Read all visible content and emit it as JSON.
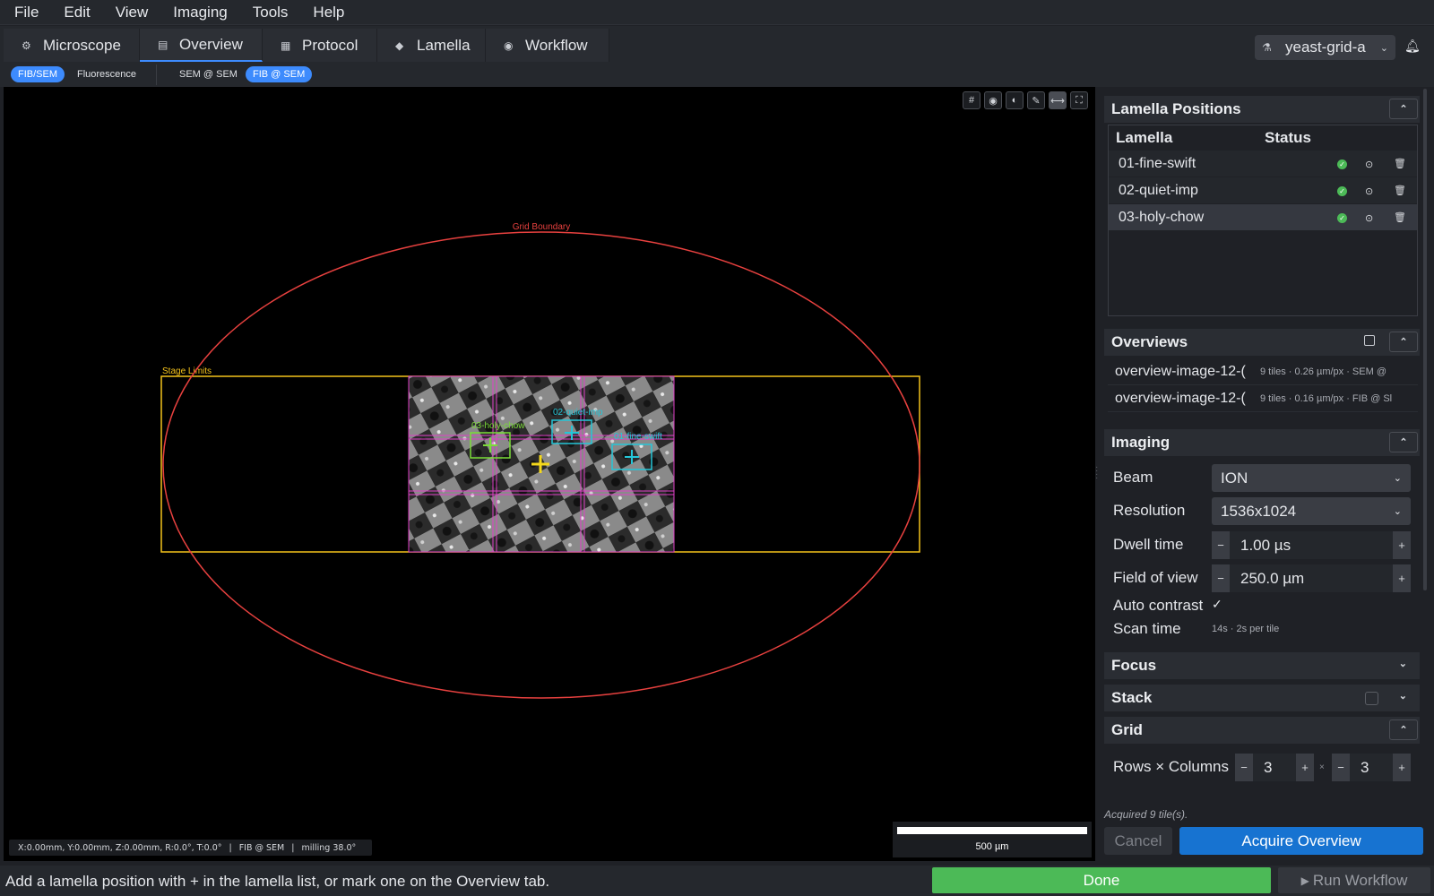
{
  "menu": [
    "File",
    "Edit",
    "View",
    "Imaging",
    "Tools",
    "Help"
  ],
  "tabs": [
    {
      "label": "Microscope",
      "icon": "microscope-icon",
      "glyph": "⚙"
    },
    {
      "label": "Overview",
      "icon": "map-icon",
      "glyph": "▤"
    },
    {
      "label": "Protocol",
      "icon": "document-icon",
      "glyph": "▦"
    },
    {
      "label": "Lamella",
      "icon": "layers-icon",
      "glyph": "◆"
    },
    {
      "label": "Workflow",
      "icon": "play-circle-icon",
      "glyph": "◉"
    }
  ],
  "active_tab": "Overview",
  "project": {
    "name": "yeast-grid-a"
  },
  "subbar": {
    "modes": [
      "FIB/SEM",
      "Fluorescence"
    ],
    "views": [
      "SEM @ SEM",
      "FIB @ SEM"
    ]
  },
  "viewer": {
    "grid_boundary_label": "Grid Boundary",
    "stage_limits_label": "Stage Limits",
    "markers": [
      {
        "label": "03-holy-chow",
        "color": "#7bdc38"
      },
      {
        "label": "02-quiet-imp",
        "color": "#24c6d8"
      },
      {
        "label": "01-fine-swift",
        "color": "#24c6d8"
      }
    ],
    "coords": "X:0.00mm, Y:0.00mm, Z:0.00mm, R:0.0°, T:0.0°",
    "coord_view": "FIB @ SEM",
    "coord_milling": "milling 38.0°",
    "scale_label": "500 µm",
    "toolbar_icons": [
      "grid-icon",
      "eye-icon",
      "contrast-icon",
      "pencil-icon",
      "measure-icon",
      "fit-view-icon"
    ]
  },
  "lamella_positions": {
    "title": "Lamella Positions",
    "columns": [
      "Lamella",
      "Status"
    ],
    "rows": [
      {
        "name": "01-fine-swift",
        "status": "complete"
      },
      {
        "name": "02-quiet-imp",
        "status": "complete"
      },
      {
        "name": "03-holy-chow",
        "status": "complete"
      }
    ]
  },
  "overviews": {
    "title": "Overviews",
    "items": [
      {
        "name": "overview-image-12-(",
        "meta": "9 tiles · 0.26 µm/px · SEM @"
      },
      {
        "name": "overview-image-12-(",
        "meta": "9 tiles · 0.16 µm/px · FIB @ Sl"
      }
    ]
  },
  "imaging": {
    "title": "Imaging",
    "beam_label": "Beam",
    "beam_value": "ION",
    "resolution_label": "Resolution",
    "resolution_value": "1536x1024",
    "dwell_label": "Dwell time",
    "dwell_value": "1.00  µs",
    "fov_label": "Field of view",
    "fov_value": "250.0  µm",
    "auto_contrast_label": "Auto contrast",
    "auto_contrast": true,
    "scan_time_label": "Scan time",
    "scan_time_value": "14s  ·  2s per tile"
  },
  "focus": {
    "title": "Focus"
  },
  "stack": {
    "title": "Stack"
  },
  "grid": {
    "title": "Grid",
    "rows_cols_label": "Rows × Columns",
    "rows": "3",
    "cols": "3",
    "times": "×"
  },
  "footer": {
    "acquired_text": "Acquired 9 tile(s).",
    "cancel_label": "Cancel",
    "acquire_label": "Acquire Overview"
  },
  "statusbar": {
    "message": "Add a lamella position with + in the lamella list, or mark one on the Overview tab.",
    "done_label": "Done",
    "run_label": "Run Workflow"
  },
  "colors": {
    "accent": "#3d8bfd",
    "done": "#4cba57",
    "grid_boundary": "#e8413f",
    "stage_limits": "#f4c21b",
    "tile_border": "#e040c8"
  }
}
